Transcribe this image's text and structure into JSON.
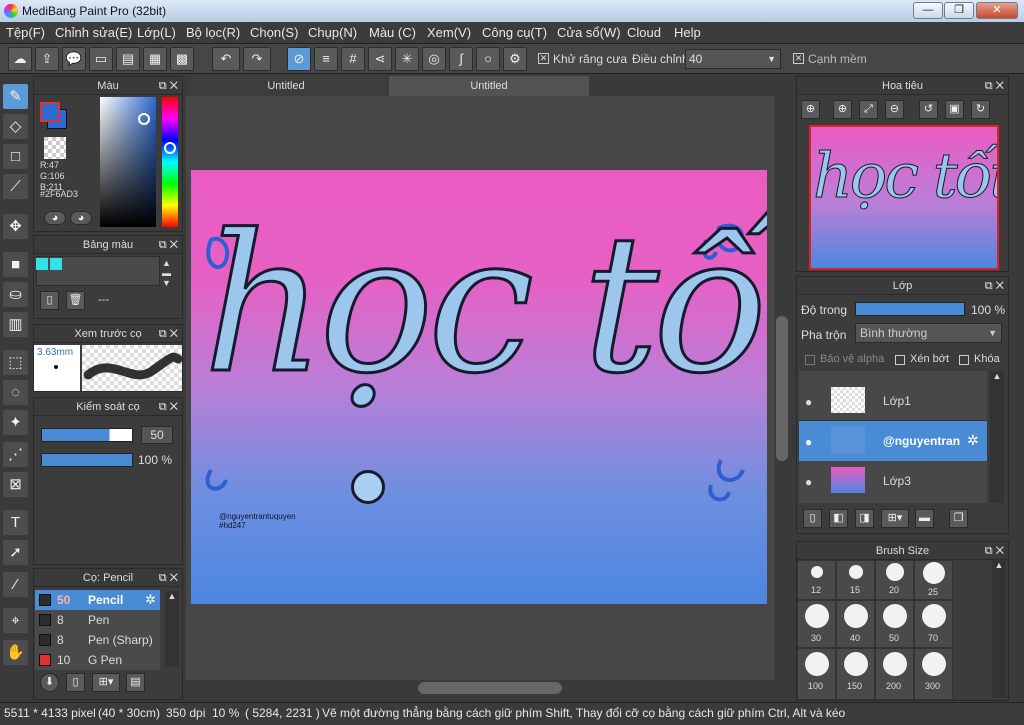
{
  "window": {
    "title": "MediBang Paint Pro (32bit)",
    "minimize": "—",
    "maximize": "❐",
    "close": "✕"
  },
  "menu": [
    "Tệp(F)",
    "Chỉnh sửa(E)",
    "Lớp(L)",
    "Bộ lọc(R)",
    "Chọn(S)",
    "Chụp(N)",
    "Màu (C)",
    "Xem(V)",
    "Công cụ(T)",
    "Cửa sổ(W)",
    "Cloud",
    "Help"
  ],
  "toolbar": {
    "antialias_label": "Khử răng cưa",
    "adjust_label": "Điều chỉnh",
    "adjust_value": "40",
    "smooth_label": "Cạnh mềm"
  },
  "color_panel": {
    "title": "Màu",
    "r": "R:47",
    "g": "G:106",
    "b": "B:211",
    "hex": "#2F6AD3",
    "primary": "#2f6ad3",
    "secondary": "#2f6ad3"
  },
  "palette_panel": {
    "title": "Bảng màu",
    "swatches": [
      "#34e0e6",
      "#34e0e6"
    ],
    "separator": "---"
  },
  "brush_preview": {
    "title": "Xem trước cọ",
    "size": "3.63mm"
  },
  "brush_control": {
    "title": "Kiểm soát cọ",
    "size": "50",
    "opacity": "100 %"
  },
  "brush_list": {
    "title": "Cọ: Pencil",
    "items": [
      {
        "size": "50",
        "name": "Pencil",
        "color": "#2d2d2d",
        "selected": true
      },
      {
        "size": "8",
        "name": "Pen",
        "color": "#2d2d2d",
        "selected": false
      },
      {
        "size": "8",
        "name": "Pen (Sharp)",
        "color": "#2d2d2d",
        "selected": false
      },
      {
        "size": "10",
        "name": "G Pen",
        "color": "#e03030",
        "selected": false
      }
    ]
  },
  "tabs": [
    "Untitled",
    "Untitled"
  ],
  "canvas": {
    "main_text": "học tốt",
    "watermark_line1": "@nguyentrantuquyen",
    "watermark_line2": "#hd247"
  },
  "navigator": {
    "title": "Hoa tiêu"
  },
  "layer_panel": {
    "title": "Lớp",
    "opacity_label": "Độ trong",
    "opacity_value": "100 %",
    "blend_label": "Pha trộn",
    "blend_value": "Bình thường",
    "protect_alpha": "Bảo vệ alpha",
    "clipping": "Xén bớt",
    "lock": "Khóa",
    "layers": [
      {
        "name": "Lớp1",
        "selected": false
      },
      {
        "name": "@nguyentran",
        "selected": true
      },
      {
        "name": "Lớp3",
        "selected": false
      }
    ]
  },
  "brush_size": {
    "title": "Brush Size",
    "sizes": [
      "12",
      "15",
      "20",
      "25",
      "30",
      "40",
      "50",
      "70",
      "100",
      "150",
      "200",
      "300"
    ]
  },
  "status": {
    "dims": "5511 * 4133 pixel",
    "cm": "(40 * 30cm)",
    "dpi": "350 dpi",
    "zoom": "10 %",
    "coords": "( 5284, 2231 )",
    "hint": "Vẽ một đường thẳng bằng cách giữ phím Shift, Thay đổi cỡ cọ bằng cách giữ phím Ctrl, Alt và kéo"
  }
}
